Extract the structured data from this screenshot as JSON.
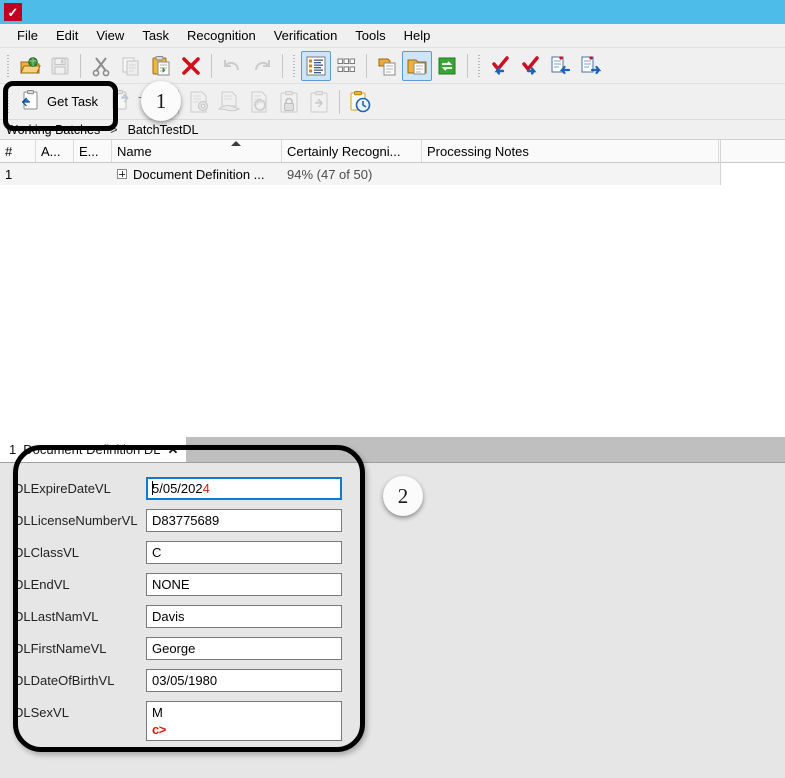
{
  "window": {
    "title": "",
    "icon": "checkmark-icon",
    "titlebar_color": "#4DBCE9"
  },
  "menubar": {
    "items": [
      {
        "label": "File"
      },
      {
        "label": "Edit"
      },
      {
        "label": "View"
      },
      {
        "label": "Task"
      },
      {
        "label": "Recognition"
      },
      {
        "label": "Verification"
      },
      {
        "label": "Tools"
      },
      {
        "label": "Help"
      }
    ]
  },
  "toolbar_row1": {
    "buttons": [
      {
        "name": "open-icon",
        "tooltip": "Open"
      },
      {
        "name": "save-icon",
        "tooltip": "Save"
      },
      {
        "name": "cut-icon",
        "tooltip": "Cut"
      },
      {
        "name": "copy-icon",
        "tooltip": "Copy"
      },
      {
        "name": "paste-icon",
        "tooltip": "Paste"
      },
      {
        "name": "delete-icon",
        "tooltip": "Delete"
      },
      {
        "name": "undo-icon",
        "tooltip": "Undo"
      },
      {
        "name": "redo-icon",
        "tooltip": "Redo"
      },
      {
        "name": "details-view-icon",
        "tooltip": "Details View"
      },
      {
        "name": "thumbnails-view-icon",
        "tooltip": "Thumbnails View"
      },
      {
        "name": "copy-pages-icon",
        "tooltip": "Copy Pages"
      },
      {
        "name": "open-document-icon",
        "tooltip": "Open Document"
      },
      {
        "name": "refresh-icon",
        "tooltip": "Refresh"
      },
      {
        "name": "verify-back-icon",
        "tooltip": "Previous Verified"
      },
      {
        "name": "verify-forward-icon",
        "tooltip": "Next Verified"
      },
      {
        "name": "page-back-icon",
        "tooltip": "Previous Page"
      },
      {
        "name": "page-forward-icon",
        "tooltip": "Next Page"
      }
    ]
  },
  "toolbar_row2": {
    "get_task_label": "Get Task",
    "get_task_icon": "get-task-icon",
    "close_task_label": "Task",
    "close_task_icon": "close-task-icon",
    "buttons": [
      {
        "name": "process-settings-icon",
        "tooltip": "Process Settings"
      },
      {
        "name": "scan-icon",
        "tooltip": "Scan"
      },
      {
        "name": "recognize-icon",
        "tooltip": "Recognize"
      },
      {
        "name": "lock-task-icon",
        "tooltip": "Lock Task"
      },
      {
        "name": "release-task-icon",
        "tooltip": "Release Task"
      },
      {
        "name": "task-history-icon",
        "tooltip": "Task History"
      }
    ]
  },
  "breadcrumb": {
    "root": "Working Batches",
    "separator": ">",
    "current": "BatchTestDL"
  },
  "grid": {
    "columns": [
      {
        "key": "num",
        "label": "#"
      },
      {
        "key": "a",
        "label": "A..."
      },
      {
        "key": "e",
        "label": "E..."
      },
      {
        "key": "name",
        "label": "Name",
        "sorted": "asc"
      },
      {
        "key": "cert",
        "label": "Certainly Recogni..."
      },
      {
        "key": "notes",
        "label": "Processing Notes"
      },
      {
        "key": "tail",
        "label": ""
      }
    ],
    "rows": [
      {
        "num": "1",
        "a": "",
        "e": "",
        "name": "Document Definition ...",
        "cert": "94% (47 of 50)",
        "notes": "",
        "expandable": true
      }
    ]
  },
  "document_panel": {
    "tab": {
      "index": "1",
      "label": "Document Definition DL",
      "close": "✕"
    },
    "fields": [
      {
        "label": "DLExpireDateVL",
        "value": "5/05/202",
        "suffix_red": "4",
        "focused": true,
        "caret": true,
        "tall": false,
        "second_line": ""
      },
      {
        "label": "DLLicenseNumberVL",
        "value": "D83775689",
        "suffix_red": "",
        "focused": false,
        "caret": false,
        "tall": false,
        "second_line": ""
      },
      {
        "label": "DLClassVL",
        "value": "C",
        "suffix_red": "",
        "focused": false,
        "caret": false,
        "tall": false,
        "second_line": ""
      },
      {
        "label": "DLEndVL",
        "value": "NONE",
        "suffix_red": "",
        "focused": false,
        "caret": false,
        "tall": false,
        "second_line": ""
      },
      {
        "label": "DLLastNamVL",
        "value": "Davis",
        "suffix_red": "",
        "focused": false,
        "caret": false,
        "tall": false,
        "second_line": ""
      },
      {
        "label": "DLFirstNameVL",
        "value": "George",
        "suffix_red": "",
        "focused": false,
        "caret": false,
        "tall": false,
        "second_line": ""
      },
      {
        "label": "DLDateOfBirthVL",
        "value": "03/05/1980",
        "suffix_red": "",
        "focused": false,
        "caret": false,
        "tall": false,
        "second_line": ""
      },
      {
        "label": "DLSexVL",
        "value": "M",
        "suffix_red": "",
        "focused": false,
        "caret": false,
        "tall": true,
        "second_line": "c>"
      }
    ]
  },
  "annotations": [
    {
      "id": "1",
      "label": "1",
      "target": "get-task-button"
    },
    {
      "id": "2",
      "label": "2",
      "target": "document-fields-panel"
    }
  ],
  "colors": {
    "accent": "#4DBCE9",
    "focus_border": "#1479D1",
    "error_text": "#E01B10",
    "panel_bg": "#E6E6E6",
    "toolbar_bg": "#F0F0F0"
  }
}
